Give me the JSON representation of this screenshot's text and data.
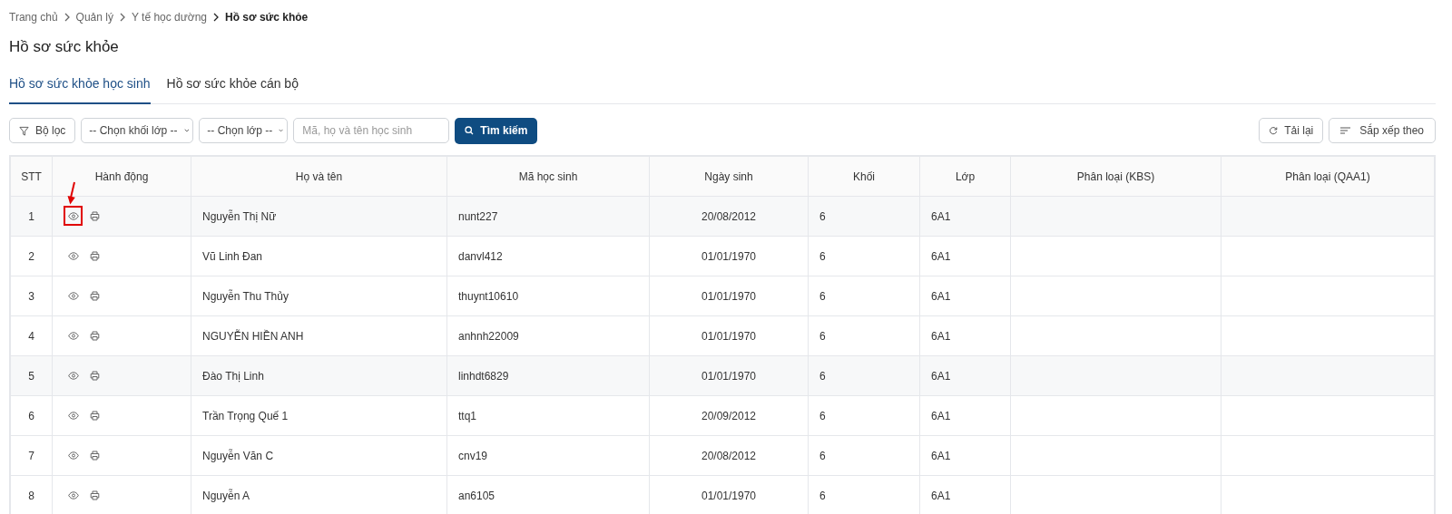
{
  "breadcrumb": [
    {
      "label": "Trang chủ",
      "current": false
    },
    {
      "label": "Quản lý",
      "current": false
    },
    {
      "label": "Y tế học dường",
      "current": false
    },
    {
      "label": "Hồ sơ sức khỏe",
      "current": true
    }
  ],
  "page_title": "Hồ sơ sức khỏe",
  "tabs": [
    {
      "label": "Hồ sơ sức khỏe học sinh",
      "selected": true
    },
    {
      "label": "Hồ sơ sức khỏe cán bộ",
      "selected": false
    }
  ],
  "toolbar": {
    "filter_button": "Bộ lọc",
    "grade_select": "-- Chọn khối lớp --",
    "class_select": "-- Chọn lớp --",
    "search": {
      "placeholder": "Mã, họ và tên học sinh"
    },
    "search_button": "Tìm kiếm",
    "reload_button": "Tải lại",
    "sort_button": "Sắp xếp theo"
  },
  "table": {
    "columns": [
      "STT",
      "Hành động",
      "Họ và tên",
      "Mã học sinh",
      "Ngày sinh",
      "Khối",
      "Lớp",
      "Phân loại (KBS)",
      "Phân loại (QAA1)"
    ],
    "rows": [
      {
        "stt": "1",
        "name": "Nguyễn Thị Nữ",
        "code": "nunt227",
        "dob": "20/08/2012",
        "grade": "6",
        "class": "6A1",
        "highlighted": true,
        "annotated": true
      },
      {
        "stt": "2",
        "name": "Vũ Linh Đan",
        "code": "danvl412",
        "dob": "01/01/1970",
        "grade": "6",
        "class": "6A1",
        "highlighted": false,
        "annotated": false
      },
      {
        "stt": "3",
        "name": "Nguyễn Thu Thủy",
        "code": "thuynt10610",
        "dob": "01/01/1970",
        "grade": "6",
        "class": "6A1",
        "highlighted": false,
        "annotated": false
      },
      {
        "stt": "4",
        "name": "NGUYỄN HIỀN ANH",
        "code": "anhnh22009",
        "dob": "01/01/1970",
        "grade": "6",
        "class": "6A1",
        "highlighted": false,
        "annotated": false
      },
      {
        "stt": "5",
        "name": "Đào Thị Linh",
        "code": "linhdt6829",
        "dob": "01/01/1970",
        "grade": "6",
        "class": "6A1",
        "highlighted": true,
        "annotated": false
      },
      {
        "stt": "6",
        "name": "Trần Trọng Quế 1",
        "code": "ttq1",
        "dob": "20/09/2012",
        "grade": "6",
        "class": "6A1",
        "highlighted": false,
        "annotated": false
      },
      {
        "stt": "7",
        "name": "Nguyễn Văn C",
        "code": "cnv19",
        "dob": "20/08/2012",
        "grade": "6",
        "class": "6A1",
        "highlighted": false,
        "annotated": false
      },
      {
        "stt": "8",
        "name": "Nguyễn A",
        "code": "an6105",
        "dob": "01/01/1970",
        "grade": "6",
        "class": "6A1",
        "highlighted": false,
        "annotated": false
      }
    ]
  }
}
